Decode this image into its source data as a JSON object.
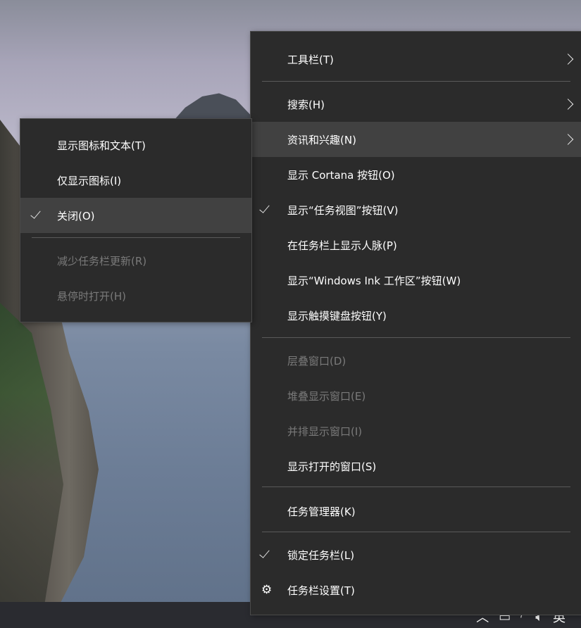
{
  "taskbar_menu": {
    "items": [
      {
        "label": "工具栏(T)",
        "has_submenu": true
      },
      {
        "label": "搜索(H)",
        "has_submenu": true
      },
      {
        "label": "资讯和兴趣(N)",
        "has_submenu": true,
        "highlighted": true
      },
      {
        "label": "显示 Cortana 按钮(O)"
      },
      {
        "label": "显示“任务视图”按钮(V)",
        "checked": true
      },
      {
        "label": "在任务栏上显示人脉(P)"
      },
      {
        "label": "显示“Windows Ink 工作区”按钮(W)"
      },
      {
        "label": "显示触摸键盘按钮(Y)"
      },
      {
        "label": "层叠窗口(D)",
        "disabled": true
      },
      {
        "label": "堆叠显示窗口(E)",
        "disabled": true
      },
      {
        "label": "并排显示窗口(I)",
        "disabled": true
      },
      {
        "label": "显示打开的窗口(S)"
      },
      {
        "label": "任务管理器(K)"
      },
      {
        "label": "锁定任务栏(L)",
        "checked": true
      },
      {
        "label": "任务栏设置(T)",
        "icon": "gear-icon"
      }
    ]
  },
  "news_submenu": {
    "items": [
      {
        "label": "显示图标和文本(T)"
      },
      {
        "label": "仅显示图标(I)"
      },
      {
        "label": "关闭(O)",
        "checked": true,
        "highlighted": true
      },
      {
        "label": "减少任务栏更新(R)",
        "disabled": true
      },
      {
        "label": "悬停时打开(H)",
        "disabled": true
      }
    ]
  },
  "tray": {
    "chevron_icon": "chevron-up-icon",
    "action_center_icon": "notification-icon",
    "network_icon": "network-icon",
    "volume_icon": "volume-icon",
    "ime_label": "英"
  },
  "colors": {
    "menu_bg": "#2b2b2b",
    "menu_highlight": "#414141",
    "disabled_text": "#7a7a7a"
  }
}
